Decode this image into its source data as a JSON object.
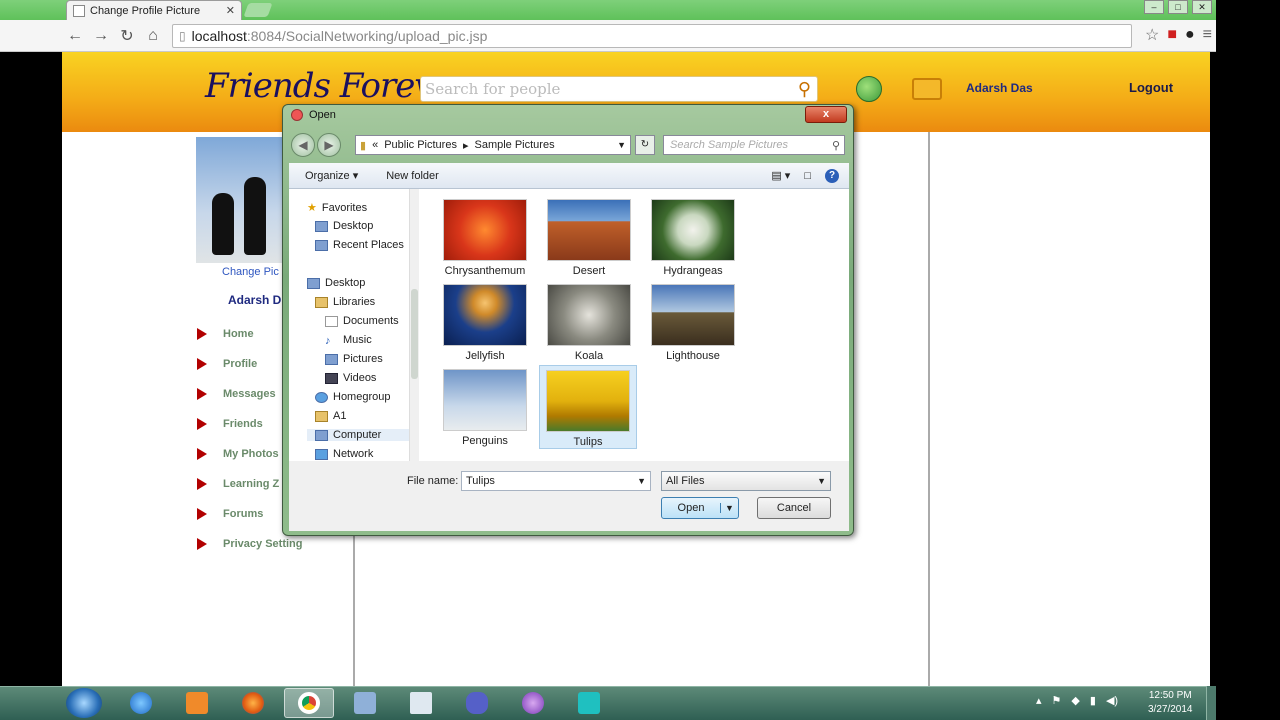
{
  "browser": {
    "tab_title": "Change Profile Picture",
    "tab_close": "✕",
    "url_host": "localhost",
    "url_path": ":8084/SocialNetworking/upload_pic.jsp"
  },
  "site": {
    "logo": "Friends Forever",
    "search_placeholder": "Search for people",
    "user_name": "Adarsh Das",
    "logout": "Logout",
    "change_pic_link": "Change Pic",
    "profile_name": "Adarsh D",
    "nav": [
      {
        "label": "Home"
      },
      {
        "label": "Profile"
      },
      {
        "label": "Messages"
      },
      {
        "label": "Friends"
      },
      {
        "label": "My Photos"
      },
      {
        "label": "Learning Z"
      },
      {
        "label": "Forums"
      },
      {
        "label": "Privacy Setting"
      }
    ]
  },
  "dialog": {
    "title": "Open",
    "close": "x",
    "path": [
      "Public Pictures",
      "Sample Pictures"
    ],
    "search_placeholder": "Search Sample Pictures",
    "organize": "Organize ▾",
    "new_folder": "New folder",
    "tree": [
      {
        "label": "Favorites",
        "icon": "star-icon"
      },
      {
        "label": "Desktop",
        "icon": "desktop-icon"
      },
      {
        "label": "Recent Places",
        "icon": "recent-places-icon"
      },
      {
        "label": "Desktop",
        "icon": "desktop-icon"
      },
      {
        "label": "Libraries",
        "icon": "libraries-icon"
      },
      {
        "label": "Documents",
        "icon": "documents-icon"
      },
      {
        "label": "Music",
        "icon": "music-icon"
      },
      {
        "label": "Pictures",
        "icon": "pictures-icon"
      },
      {
        "label": "Videos",
        "icon": "videos-icon"
      },
      {
        "label": "Homegroup",
        "icon": "homegroup-icon"
      },
      {
        "label": "A1",
        "icon": "folder-icon"
      },
      {
        "label": "Computer",
        "icon": "computer-icon"
      },
      {
        "label": "Network",
        "icon": "network-icon"
      }
    ],
    "files": [
      {
        "name": "Chrysanthemum",
        "color": "#d9361a"
      },
      {
        "name": "Desert",
        "color": "#b0502a"
      },
      {
        "name": "Hydrangeas",
        "color": "#3e6b2e"
      },
      {
        "name": "Jellyfish",
        "color": "#1b3f8a"
      },
      {
        "name": "Koala",
        "color": "#8a8a80"
      },
      {
        "name": "Lighthouse",
        "color": "#4a76b8"
      },
      {
        "name": "Penguins",
        "color": "#6f95c8"
      },
      {
        "name": "Tulips",
        "color": "#e2b10e"
      }
    ],
    "file_name_label": "File name:",
    "file_name_value": "Tulips",
    "filter_value": "All Files",
    "open_label": "Open",
    "cancel_label": "Cancel"
  },
  "taskbar": {
    "time": "12:50 PM",
    "date": "3/27/2014"
  }
}
